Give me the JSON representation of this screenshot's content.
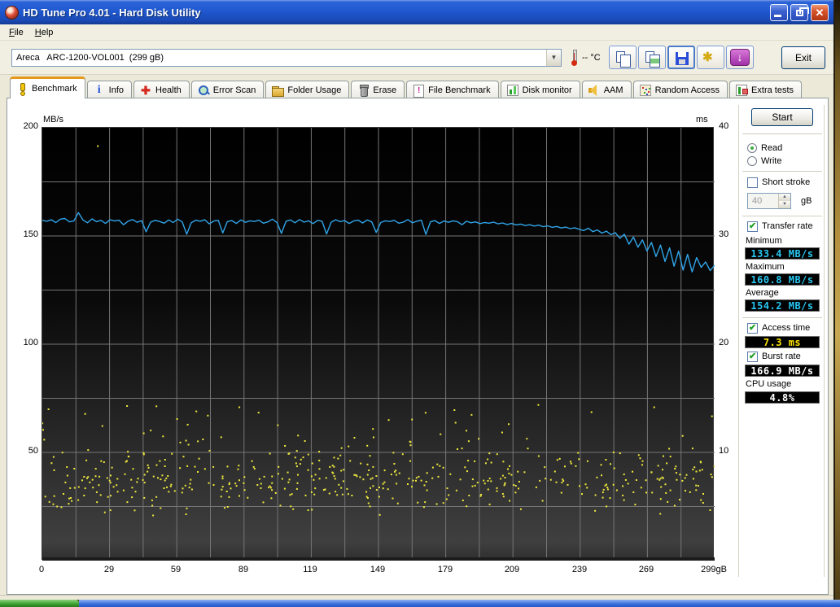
{
  "window": {
    "title": "HD Tune Pro 4.01 - Hard Disk Utility"
  },
  "menu": {
    "items": [
      "File",
      "Help"
    ]
  },
  "toolbar": {
    "drive_selector": "Areca   ARC-1200-VOL001  (299 gB)",
    "temperature": "-- °C",
    "exit_label": "Exit"
  },
  "tabs": [
    {
      "label": "Benchmark"
    },
    {
      "label": "Info"
    },
    {
      "label": "Health"
    },
    {
      "label": "Error Scan"
    },
    {
      "label": "Folder Usage"
    },
    {
      "label": "Erase"
    },
    {
      "label": "File Benchmark"
    },
    {
      "label": "Disk monitor"
    },
    {
      "label": "AAM"
    },
    {
      "label": "Random Access"
    },
    {
      "label": "Extra tests"
    }
  ],
  "controls": {
    "start_label": "Start",
    "read_label": "Read",
    "write_label": "Write",
    "short_stroke_label": "Short stroke",
    "short_stroke_value": "40",
    "short_stroke_unit": "gB",
    "transfer_rate_label": "Transfer rate",
    "minimum_label": "Minimum",
    "minimum_value": "133.4 MB/s",
    "maximum_label": "Maximum",
    "maximum_value": "160.8 MB/s",
    "average_label": "Average",
    "average_value": "154.2 MB/s",
    "access_time_label": "Access time",
    "access_time_value": "7.3 ms",
    "burst_rate_label": "Burst rate",
    "burst_rate_value": "166.9 MB/s",
    "cpu_usage_label": "CPU usage",
    "cpu_usage_value": "4.8%"
  },
  "chart_data": {
    "type": "line",
    "title": "HD Tune benchmark - transfer rate (line) and access time (scatter)",
    "x_max": 299,
    "x_unit": "gB",
    "x_tick_labels": [
      "0",
      "29",
      "59",
      "89",
      "119",
      "149",
      "179",
      "209",
      "239",
      "269",
      "299gB"
    ],
    "y_left": {
      "unit": "MB/s",
      "max": 200,
      "tick_values": [
        200,
        150,
        100,
        50
      ]
    },
    "y_right": {
      "unit": "ms",
      "max": 40,
      "tick_values": [
        40,
        30,
        20,
        10
      ]
    },
    "grid": {
      "v_divisions": 20,
      "h_divisions": 8
    },
    "series": [
      {
        "name": "transfer_rate",
        "type": "line",
        "color": "#30a4e8",
        "unit": "MB/s",
        "summary": {
          "min": 133.4,
          "max": 160.8,
          "avg": 154.2
        },
        "values": [
          157.2,
          156.8,
          157.5,
          156.2,
          157.8,
          158.1,
          156.5,
          157.0,
          160.8,
          157.4,
          156.1,
          157.9,
          156.6,
          157.2,
          155.8,
          157.5,
          156.9,
          157.3,
          155.2,
          156.8,
          157.6,
          156.3,
          157.1,
          151.9,
          156.4,
          157.2,
          156.7,
          155.9,
          157.4,
          156.2,
          157.8,
          156.5,
          150.8,
          156.1,
          157.3,
          156.8,
          157.5,
          155.6,
          156.9,
          157.2,
          151.4,
          156.6,
          157.1,
          155.8,
          157.4,
          156.3,
          157.0,
          156.7,
          157.3,
          155.9,
          156.5,
          157.8,
          156.2,
          151.2,
          156.8,
          157.4,
          156.1,
          157.6,
          156.4,
          157.0,
          155.7,
          157.2,
          156.8,
          150.9,
          156.3,
          157.5,
          156.6,
          157.1,
          155.8,
          156.9,
          157.3,
          156.0,
          157.4,
          156.5,
          151.6,
          156.2,
          157.0,
          156.7,
          157.2,
          155.9,
          156.4,
          157.6,
          156.1,
          156.8,
          157.3,
          150.7,
          156.5,
          157.1,
          155.8,
          156.9,
          156.3,
          157.0,
          156.6,
          155.2,
          156.8,
          156.1,
          156.5,
          155.7,
          156.2,
          155.9,
          156.4,
          155.6,
          156.0,
          155.3,
          155.8,
          155.1,
          155.5,
          154.8,
          155.2,
          154.6,
          155.0,
          154.3,
          154.7,
          154.0,
          154.4,
          153.7,
          154.1,
          153.4,
          153.8,
          153.1,
          152.5,
          153.6,
          152.0,
          152.8,
          151.3,
          152.2,
          150.6,
          151.5,
          148.9,
          150.8,
          146.2,
          149.5,
          144.8,
          148.2,
          143.1,
          147.0,
          140.5,
          145.8,
          138.2,
          144.5,
          136.0,
          143.0,
          134.2,
          141.5,
          133.4,
          140.0,
          135.5,
          138.0,
          134.0,
          136.5
        ]
      },
      {
        "name": "access_time",
        "type": "scatter",
        "color": "#efe93c",
        "unit": "ms",
        "summary": {
          "avg": 7.3
        },
        "cluster": {
          "count": 480,
          "x_range": [
            0,
            299
          ],
          "ms_range": [
            4.0,
            11.2
          ],
          "distribution": "triangular",
          "seed": 1337
        },
        "sparse": {
          "count": 45,
          "ms_range": [
            11.0,
            14.5
          ]
        },
        "outliers": [
          [
            24.7,
            38.3
          ]
        ]
      }
    ]
  }
}
